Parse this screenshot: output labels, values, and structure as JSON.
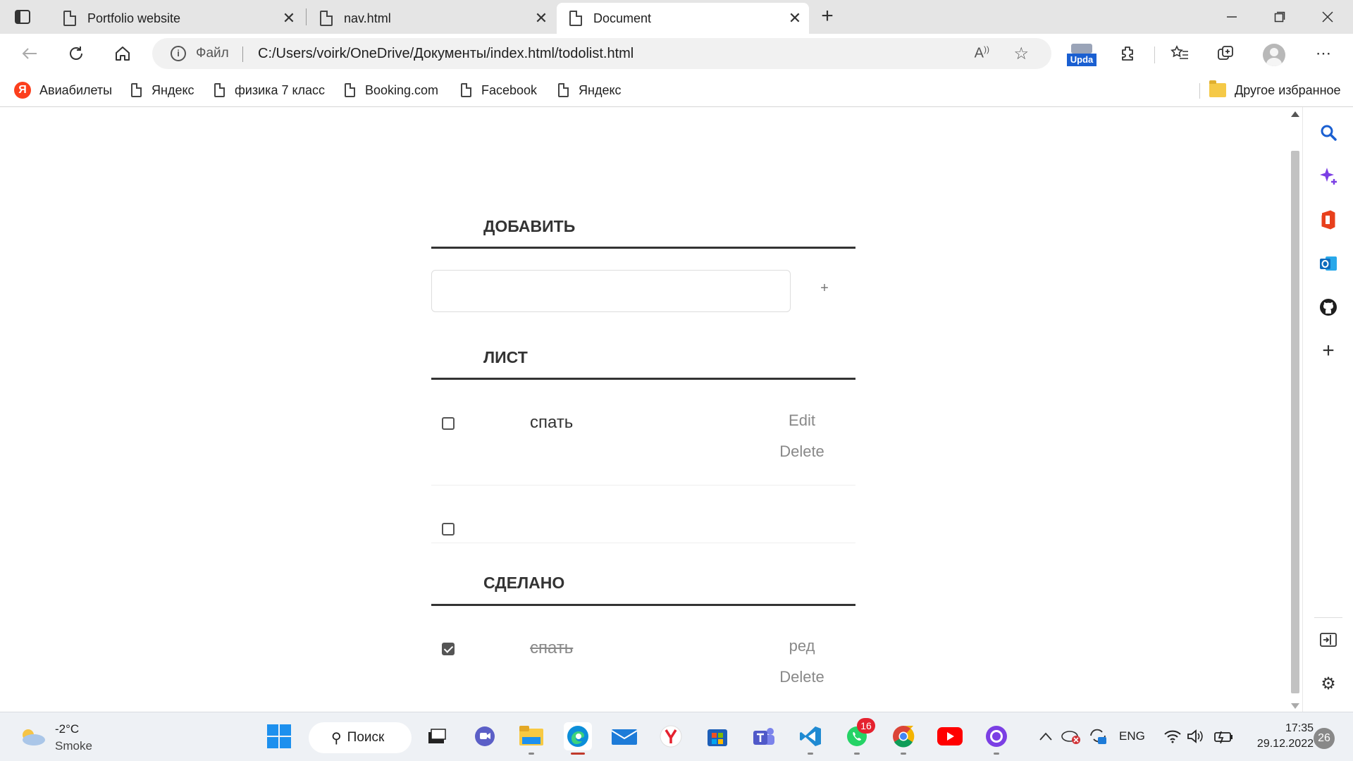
{
  "browser": {
    "tabs": [
      {
        "title": "Portfolio website"
      },
      {
        "title": "nav.html"
      },
      {
        "title": "Document"
      }
    ],
    "address": {
      "scheme_label": "Файл",
      "url": "C:/Users/voirk/OneDrive/Документы/index.html/todolist.html"
    },
    "extensions": {
      "update_label": "Upda"
    },
    "bookmarks": [
      {
        "label": "Авиабилеты",
        "icon": "yandex-icon"
      },
      {
        "label": "Яндекс",
        "icon": "page-icon"
      },
      {
        "label": "физика 7 класс",
        "icon": "page-icon"
      },
      {
        "label": "Booking.com",
        "icon": "page-icon"
      },
      {
        "label": "Facebook",
        "icon": "page-icon"
      },
      {
        "label": "Яндекс",
        "icon": "page-icon"
      }
    ],
    "other_favorites": "Другое избранное",
    "yandex_letter": "Я"
  },
  "todo": {
    "add_title": "ДОБАВИТЬ",
    "add_button": "+",
    "add_input_value": "",
    "list_title": "ЛИСТ",
    "list_items": [
      {
        "text": "спать",
        "checked": false,
        "edit": "Edit",
        "delete": "Delete"
      },
      {
        "text": "",
        "checked": false
      }
    ],
    "done_title": "СДЕЛАНО",
    "done_items": [
      {
        "text": "спать",
        "checked": true,
        "edit": "ред",
        "delete": "Delete"
      }
    ]
  },
  "taskbar": {
    "weather": {
      "temp": "-2°C",
      "condition": "Smoke"
    },
    "search_label": "Поиск",
    "whatsapp_badge": "16",
    "language": "ENG",
    "time": "17:35",
    "date": "29.12.2022",
    "notifications": "26"
  }
}
